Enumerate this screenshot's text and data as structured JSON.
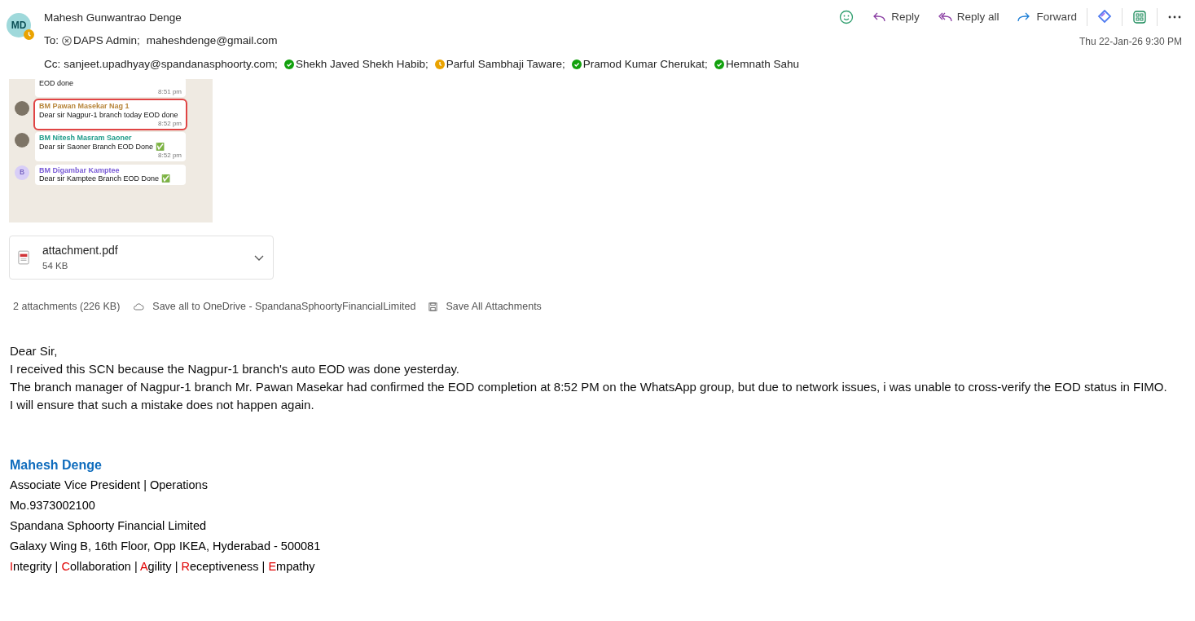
{
  "header": {
    "avatar": {
      "initials": "MD",
      "kind": "away"
    },
    "sender": "Mahesh Gunwantrao Denge",
    "separator": ";",
    "to_label": "To:",
    "to": [
      {
        "name": "DAPS Admin",
        "kind": "blocked"
      },
      {
        "name": "maheshdenge@gmail.com",
        "kind": "plain"
      }
    ],
    "cc_label": "Cc:",
    "cc": [
      {
        "name": "sanjeet.upadhyay@spandanasphoorty.com",
        "kind": "plain"
      },
      {
        "name": "Shekh Javed Shekh Habib",
        "kind": "available"
      },
      {
        "name": "Parful Sambhaji Taware",
        "kind": "away"
      },
      {
        "name": "Pramod Kumar Cherukat",
        "kind": "available"
      },
      {
        "name": "Hemnath Sahu",
        "kind": "available"
      }
    ],
    "date": "Thu 22-Jan-26 9:30 PM"
  },
  "actions": [
    {
      "kind": "emoji"
    },
    {
      "kind": "reply",
      "label": "Reply"
    },
    {
      "kind": "replyall",
      "label": "Reply all"
    },
    {
      "kind": "forward",
      "label": "Forward"
    },
    {
      "kind": "copilot"
    },
    {
      "kind": "apps"
    },
    {
      "kind": "more"
    }
  ],
  "image_attachment": {
    "messages": [
      {
        "kind": "continuation",
        "text": "EOD done",
        "time": "8:51 pm",
        "highlighted": false
      },
      {
        "kind": "photo_avatar",
        "sender": "BM Pawan Masekar Nag 1",
        "color": "#b8863b",
        "text": "Dear sir Nagpur-1 branch today EOD done",
        "time": "8:52 pm",
        "highlighted": true
      },
      {
        "kind": "photo_avatar",
        "sender": "BM Nitesh Masram Saoner",
        "color": "#1f9c8a",
        "text": "Dear sir Saoner Branch EOD Done ✅",
        "time": "8:52 pm",
        "highlighted": false
      },
      {
        "kind": "letter_avatar",
        "sender": "BM Digambar Kamptee",
        "color": "#7a5cd6",
        "avatar": "B",
        "text": "Dear sir Kamptee Branch EOD Done ✅",
        "highlighted": false
      }
    ]
  },
  "file_attachment": {
    "name": "attachment.pdf",
    "size": "54 KB"
  },
  "attachment_bar": {
    "count": "2 attachments (226 KB)",
    "save_onedrive": "Save all to OneDrive - SpandanaSphoortyFinancialLimited",
    "save_all": "Save All Attachments"
  },
  "body": [
    "Dear Sir,",
    "I received this SCN because the Nagpur-1 branch's auto EOD was done yesterday.",
    "The branch manager of Nagpur-1 branch Mr. Pawan Masekar had confirmed the EOD completion at 8:52 PM on the WhatsApp group, but due to network issues, i was unable to cross-verify the EOD status in FIMO.",
    "I will ensure that such a mistake does not happen again."
  ],
  "signature": {
    "name": "Mahesh Denge",
    "lines": [
      "Associate Vice President | Operations",
      "Mo.9373002100",
      "Spandana Sphoorty Financial Limited",
      "Galaxy Wing B, 16th Floor, Opp IKEA, Hyderabad - 500081"
    ],
    "separator": "|",
    "values": [
      {
        "initial": "I",
        "rest": "ntegrity"
      },
      {
        "initial": "C",
        "rest": "ollaboration"
      },
      {
        "initial": "A",
        "rest": "gility"
      },
      {
        "initial": "R",
        "rest": "eceptiveness"
      },
      {
        "initial": "E",
        "rest": "mpathy"
      }
    ]
  }
}
